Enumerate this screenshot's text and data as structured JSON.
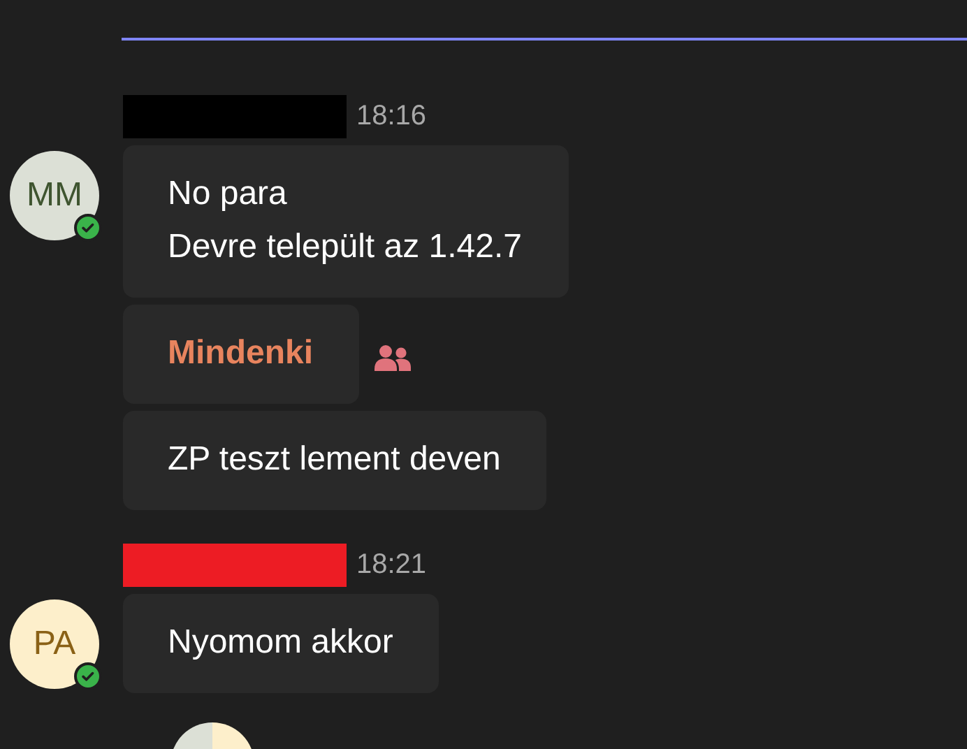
{
  "messages": [
    {
      "color": "#000000",
      "time": "18:16",
      "avatar": {
        "initials": {
          "text": "MM",
          "color": "#3f5530"
        },
        "color": "#dce0d6",
        "online": true
      },
      "bubbles": [
        {
          "kind": "text",
          "lines": [
            "No para",
            "Devre települt az 1.42.7"
          ]
        },
        {
          "kind": "mention",
          "text": "Mindenki"
        },
        {
          "kind": "text",
          "lines": [
            "ZP teszt lement deven"
          ]
        }
      ]
    },
    {
      "color": "#ed1c24",
      "time": "18:21",
      "avatar": {
        "initials": {
          "text": "PA",
          "color": "#8a6116"
        },
        "color": "#fdefcb",
        "online": true
      },
      "bubbles": [
        {
          "kind": "text",
          "lines": [
            "Nyomom akkor"
          ]
        }
      ]
    }
  ]
}
